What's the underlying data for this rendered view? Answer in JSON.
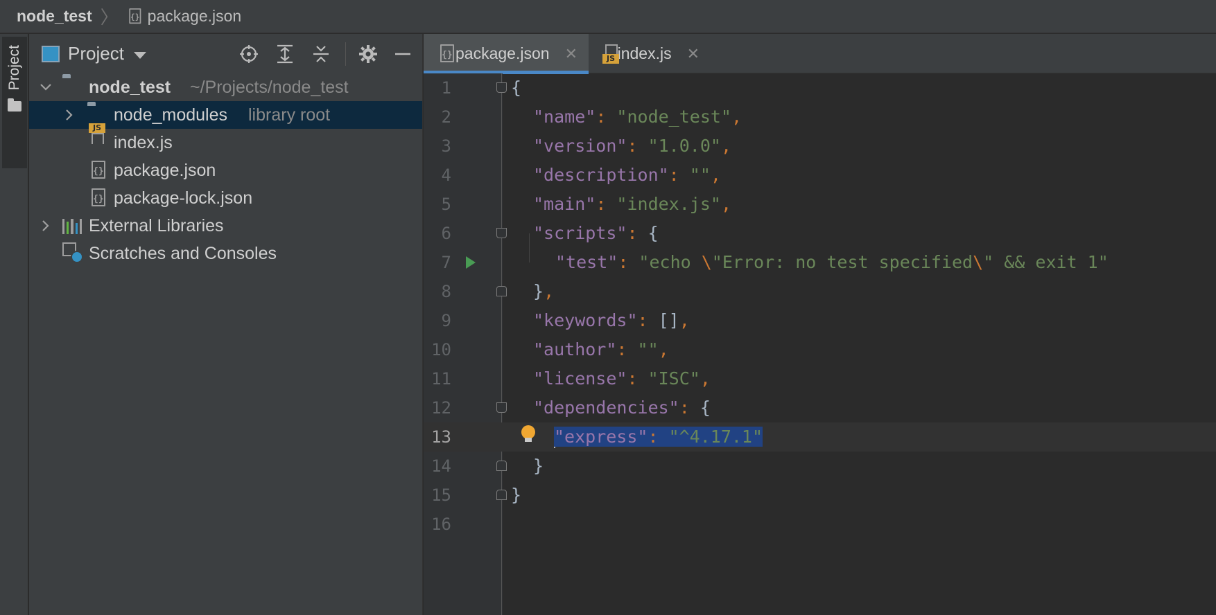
{
  "breadcrumb": {
    "root": "node_test",
    "file": "package.json"
  },
  "stripe": {
    "label": "Project"
  },
  "project_panel": {
    "title": "Project",
    "tree": [
      {
        "name": "node_test",
        "hint": "~/Projects/node_test",
        "type": "folder",
        "expanded": true
      },
      {
        "name": "node_modules",
        "hint": "library root",
        "type": "folder",
        "expanded": false,
        "selected": true
      },
      {
        "name": "index.js",
        "type": "js"
      },
      {
        "name": "package.json",
        "type": "json"
      },
      {
        "name": "package-lock.json",
        "type": "json"
      },
      {
        "name": "External Libraries",
        "type": "libraries",
        "expanded": false
      },
      {
        "name": "Scratches and Consoles",
        "type": "scratches"
      }
    ]
  },
  "editor": {
    "tabs": [
      {
        "label": "package.json",
        "active": true
      },
      {
        "label": "index.js",
        "active": false
      }
    ],
    "current_line": 13,
    "line_numbers": [
      "1",
      "2",
      "3",
      "4",
      "5",
      "6",
      "7",
      "8",
      "9",
      "10",
      "11",
      "12",
      "13",
      "14",
      "15",
      "16"
    ],
    "code": {
      "l2_key": "\"name\"",
      "l2_val": "\"node_test\"",
      "l3_key": "\"version\"",
      "l3_val": "\"1.0.0\"",
      "l4_key": "\"description\"",
      "l4_val": "\"\"",
      "l5_key": "\"main\"",
      "l5_val": "\"index.js\"",
      "l6_key": "\"scripts\"",
      "l7_key": "\"test\"",
      "l7_val_a": "\"echo ",
      "l7_val_b": "Error: no test specified",
      "l7_val_c": " && exit 1\"",
      "l9_key": "\"keywords\"",
      "l10_key": "\"author\"",
      "l10_val": "\"\"",
      "l11_key": "\"license\"",
      "l11_val": "\"ISC\"",
      "l12_key": "\"dependencies\"",
      "l13_key": "\"express\"",
      "l13_val": "\"^4.17.1\""
    }
  },
  "colors": {
    "keyword": "#9876aa",
    "string": "#6a8759",
    "punct": "#cc7832",
    "selection": "#214283",
    "accent": "#4a88c7"
  }
}
